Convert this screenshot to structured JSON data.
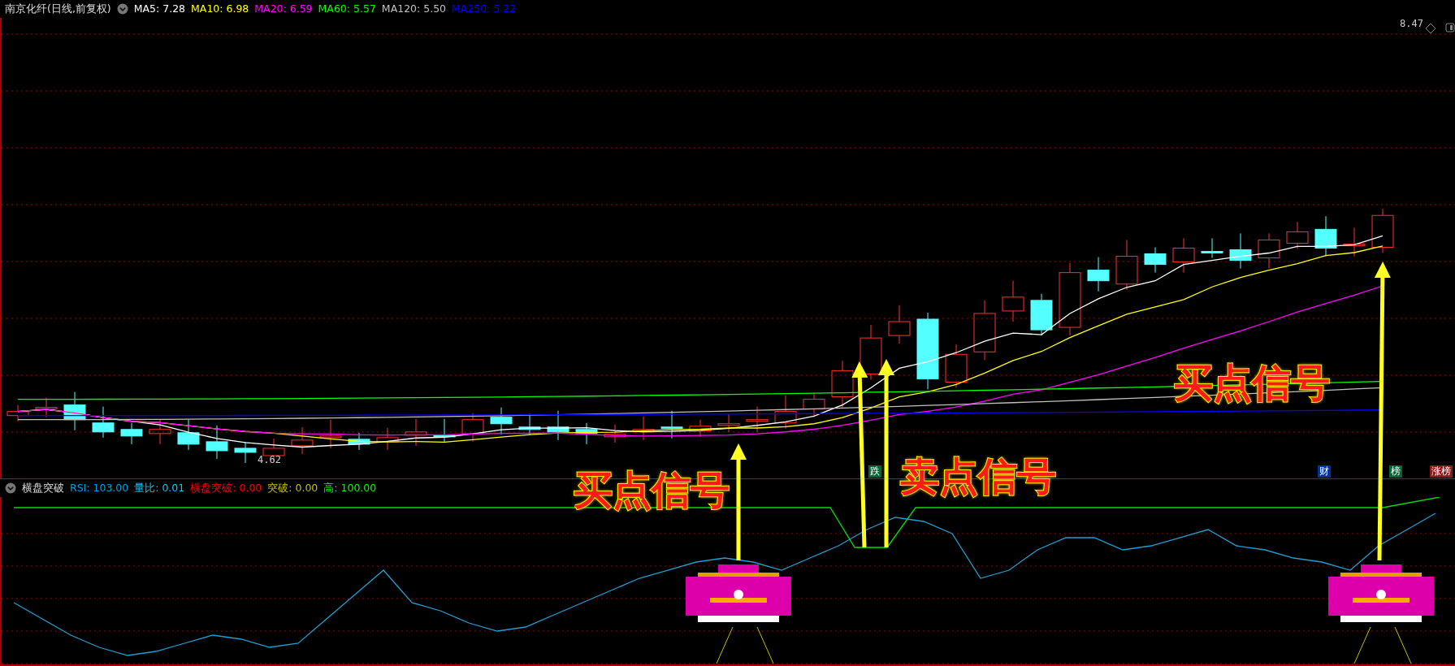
{
  "chart": {
    "title": "南京化纤(日线,前复权)",
    "legend": [
      {
        "label": "MA5: 7.28",
        "color": "#ffffff"
      },
      {
        "label": "MA10: 6.98",
        "color": "#ffff00"
      },
      {
        "label": "MA20: 6.59",
        "color": "#ff00ff"
      },
      {
        "label": "MA60: 5.57",
        "color": "#00ff00"
      },
      {
        "label": "MA120: 5.50",
        "color": "#c0c0c0"
      },
      {
        "label": "MA250: 5.22",
        "color": "#0000ff"
      }
    ],
    "high_label": "8.47",
    "low_label": "4.62",
    "badges": [
      {
        "text": "跌",
        "color": "#006633"
      },
      {
        "text": "财",
        "color": "#003399"
      },
      {
        "text": "榜",
        "color": "#006633"
      },
      {
        "text": "涨榜",
        "color": "#8b1a1a"
      }
    ]
  },
  "indicator": {
    "title": "横盘突破",
    "legend": [
      {
        "label": "RSI: 103.00",
        "color": "#00a0e0"
      },
      {
        "label": "量比: 0.01",
        "color": "#00ccff"
      },
      {
        "label": "横盘突破: 0.00",
        "color": "#ff0000"
      },
      {
        "label": "突破: 0.00",
        "color": "#c0c000"
      },
      {
        "label": "高: 100.00",
        "color": "#00ff00"
      }
    ]
  },
  "annotations": [
    {
      "text": "买点信号"
    },
    {
      "text": "卖点信号"
    },
    {
      "text": "买点信号"
    }
  ]
}
